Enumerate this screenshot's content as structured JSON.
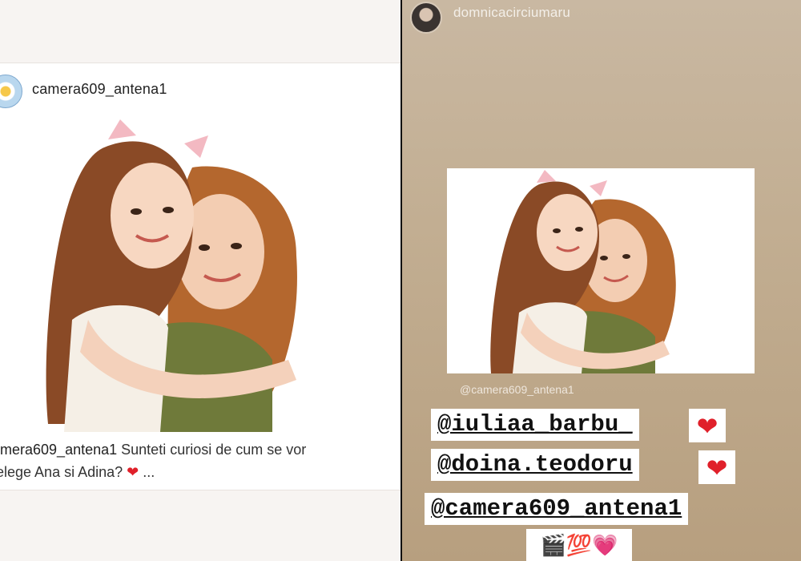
{
  "left": {
    "post": {
      "username": "camera609_antena1",
      "caption_user": "amera609_antena1",
      "caption_line1": "Sunteti curiosi de cum se vor",
      "caption_line2": "telege Ana si Adina?",
      "caption_more": "...",
      "heart": "❤"
    }
  },
  "right": {
    "story": {
      "username": "domnicacirciumaru",
      "mention_small": "@camera609_antena1",
      "tags": [
        {
          "text": "@iuliaa_barbu_",
          "heart": "❤"
        },
        {
          "text": "@doina.teodoru",
          "heart": "❤"
        },
        {
          "text": "@camera609_antena1"
        }
      ],
      "emojis": "🎬💯💗"
    }
  },
  "colors": {
    "heart": "#e0202a",
    "story_bg": "#c2ae92"
  }
}
